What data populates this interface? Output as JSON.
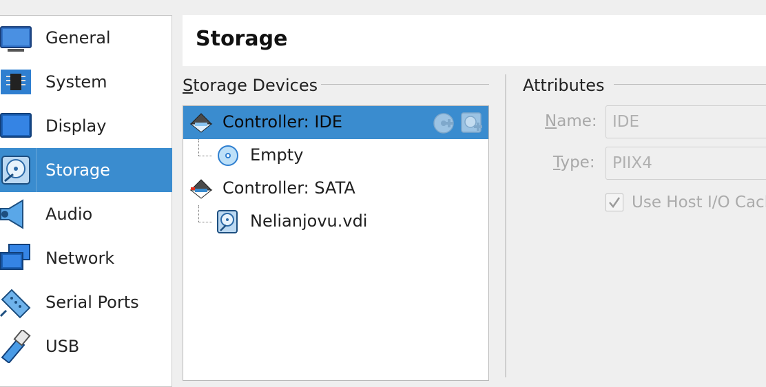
{
  "sidebar": {
    "items": [
      {
        "label": "General",
        "icon": "monitor-icon"
      },
      {
        "label": "System",
        "icon": "chip-icon"
      },
      {
        "label": "Display",
        "icon": "display-icon"
      },
      {
        "label": "Storage",
        "icon": "disk-icon",
        "selected": true
      },
      {
        "label": "Audio",
        "icon": "speaker-icon"
      },
      {
        "label": "Network",
        "icon": "network-icon"
      },
      {
        "label": "Serial Ports",
        "icon": "serial-port-icon"
      },
      {
        "label": "USB",
        "icon": "usb-icon"
      }
    ]
  },
  "header": {
    "title": "Storage"
  },
  "storage_devices": {
    "heading_first": "S",
    "heading_rest": "torage Devices",
    "tree": [
      {
        "label": "Controller: IDE",
        "type": "controller",
        "selected": true
      },
      {
        "label": "Empty",
        "type": "optical"
      },
      {
        "label": "Controller: SATA",
        "type": "controller"
      },
      {
        "label": "Nelianjovu.vdi",
        "type": "harddisk"
      }
    ]
  },
  "attributes": {
    "heading": "Attributes",
    "name_label_first": "N",
    "name_label_rest": "ame:",
    "name_value": "IDE",
    "type_label_first": "T",
    "type_label_rest": "ype:",
    "type_value": "PIIX4",
    "hostio_label": "Use Host I/O Cache",
    "hostio_checked": true
  },
  "colors": {
    "selection": "#3a8ccf",
    "accent_icon": "#2f7fd0"
  }
}
